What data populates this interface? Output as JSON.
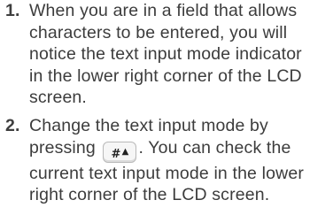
{
  "steps": [
    {
      "number": "1.",
      "lines": [
        "When you are in a field that allows",
        "characters to be entered, you will",
        "notice the text input mode indicator",
        "in the lower right corner of the LCD",
        "screen."
      ]
    },
    {
      "number": "2.",
      "line1_before_key": "Change the text input mode by",
      "line2_before_key": "pressing ",
      "line2_after_key": ". You can check the",
      "key": {
        "icon": "pound-shift-key-icon",
        "symbol": "#",
        "arrow": "▲"
      },
      "lines_after": [
        "current text input mode in the lower",
        "right corner of the LCD screen."
      ]
    }
  ]
}
